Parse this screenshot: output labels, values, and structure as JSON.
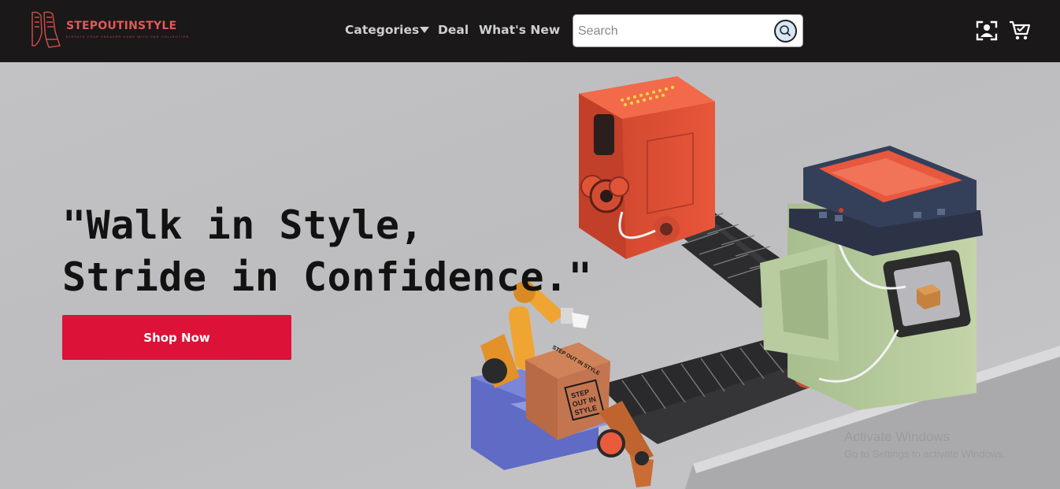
{
  "header": {
    "brand": "STEPOUTINSTYLE",
    "brand_tagline": "ELEVATE YOUR SNEAKER GAME WITH OUR COLLECTION",
    "nav": {
      "categories": "Categories",
      "deal": "Deal",
      "whats_new": "What's New"
    },
    "search": {
      "placeholder": "Search",
      "value": ""
    },
    "icons": [
      "user-account-icon",
      "cart-icon",
      "search-icon",
      "chevron-down-icon"
    ]
  },
  "hero": {
    "headline_line1": "\"Walk in Style,",
    "headline_line2": "Stride in Confidence.\"",
    "cta_label": "Shop Now",
    "box_label_lines": [
      "STEP",
      "OUT IN",
      "STYLE"
    ],
    "box_side_label": "STEP OUT IN STYLE"
  },
  "watermark": {
    "title": "Activate Windows",
    "subtitle": "Go to Settings to activate Windows."
  },
  "colors": {
    "header_bg": "#1a1818",
    "brand": "#e0595a",
    "cta": "#dc1238",
    "hero_bg": "#c2c2c4"
  }
}
